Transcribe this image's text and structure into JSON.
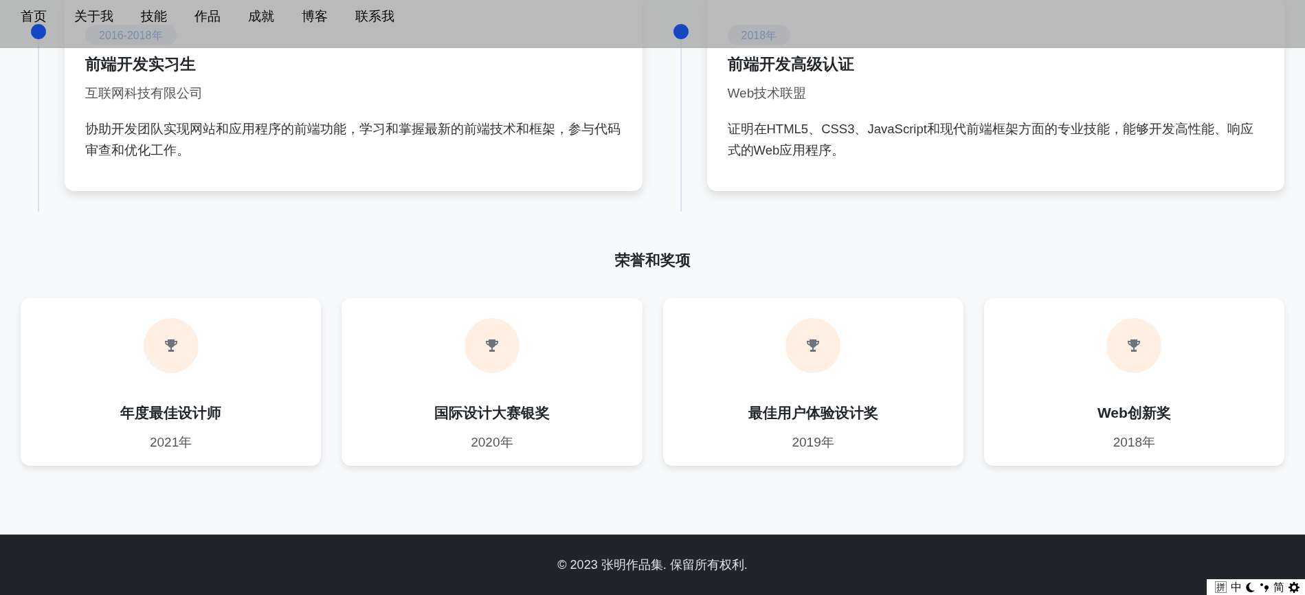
{
  "nav": {
    "items": [
      "首页",
      "关于我",
      "技能",
      "作品",
      "成就",
      "博客",
      "联系我"
    ]
  },
  "timeline": [
    {
      "period": "2016-2018年",
      "title": "前端开发实习生",
      "org": "互联网科技有限公司",
      "description": "协助开发团队实现网站和应用程序的前端功能，学习和掌握最新的前端技术和框架，参与代码审查和优化工作。"
    },
    {
      "period": "2018年",
      "title": "前端开发高级认证",
      "org": "Web技术联盟",
      "description": "证明在HTML5、CSS3、JavaScript和现代前端框架方面的专业技能，能够开发高性能、响应式的Web应用程序。"
    }
  ],
  "awards": {
    "title": "荣誉和奖项",
    "items": [
      {
        "name": "年度最佳设计师",
        "year": "2021年"
      },
      {
        "name": "国际设计大赛银奖",
        "year": "2020年"
      },
      {
        "name": "最佳用户体验设计奖",
        "year": "2019年"
      },
      {
        "name": "Web创新奖",
        "year": "2018年"
      }
    ]
  },
  "footer": {
    "text": "© 2023 张明作品集. 保留所有权利."
  },
  "ime_bar": {
    "items": [
      {
        "kind": "text",
        "label": "拼",
        "boxed": true
      },
      {
        "kind": "text",
        "label": "中",
        "boxed": false
      },
      {
        "kind": "moon"
      },
      {
        "kind": "punct"
      },
      {
        "kind": "text",
        "label": "简",
        "boxed": false
      },
      {
        "kind": "gear"
      }
    ]
  }
}
